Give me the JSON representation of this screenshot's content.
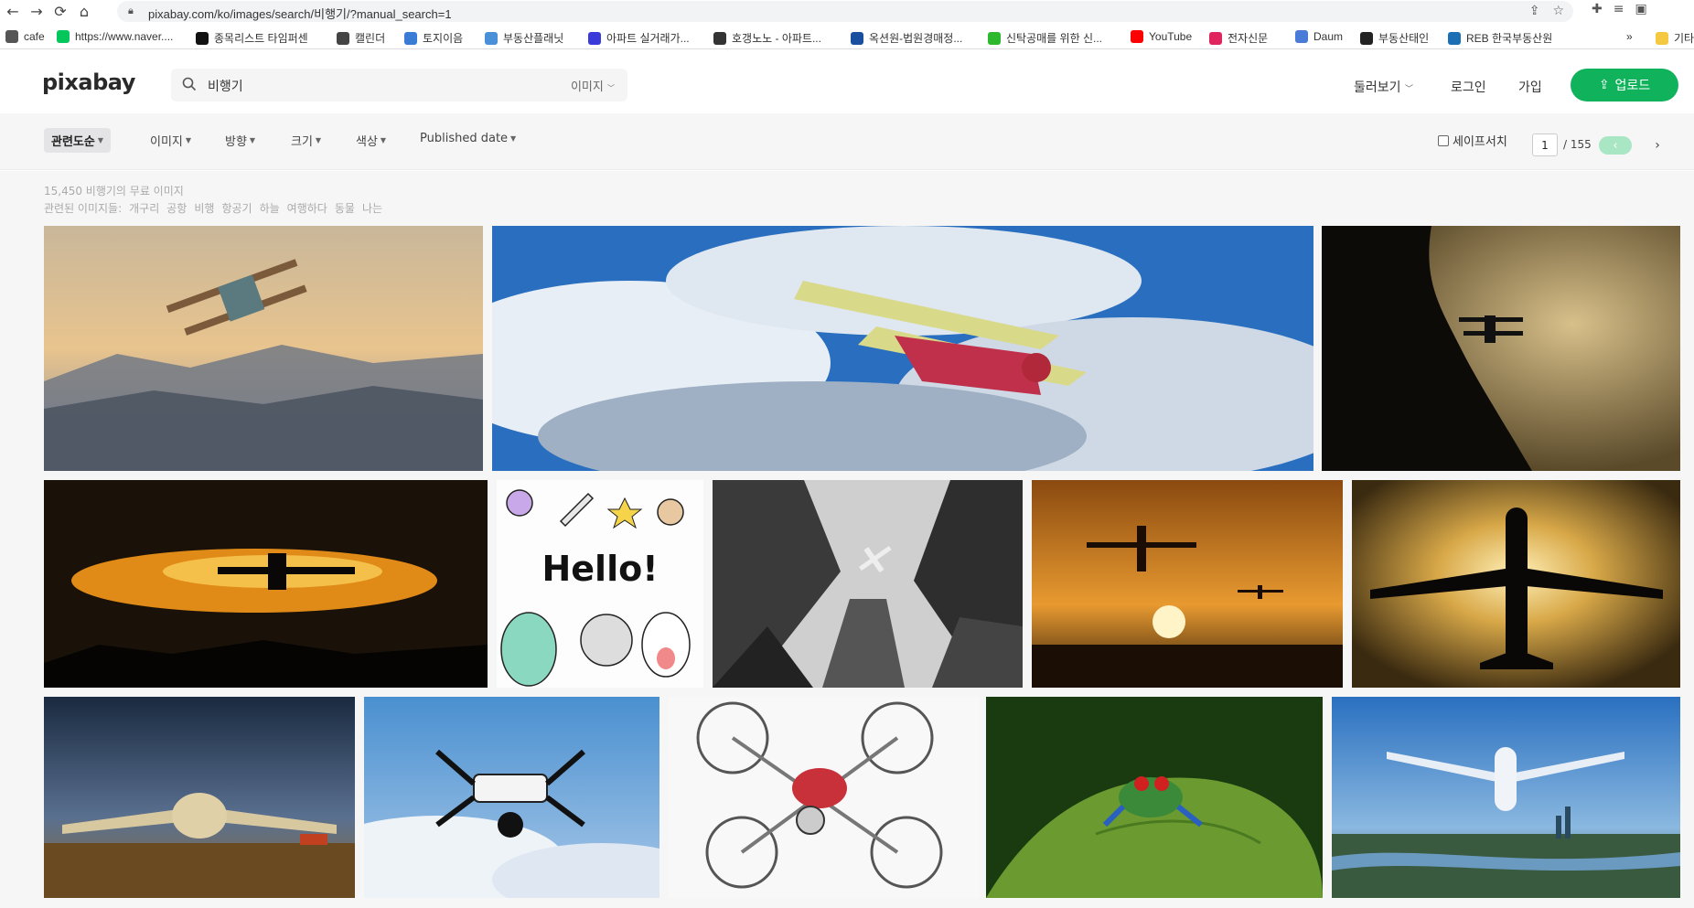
{
  "browser": {
    "url": "pixabay.com/ko/images/search/비행기/?manual_search=1",
    "bookmarks": [
      {
        "label": "cafe",
        "color": "#555555"
      },
      {
        "label": "https://www.naver....",
        "color": "#03c75a"
      },
      {
        "label": "종목리스트 타임퍼센",
        "color": "#111111"
      },
      {
        "label": "캘린더",
        "color": "#444444"
      },
      {
        "label": "토지이음",
        "color": "#3a7bd5"
      },
      {
        "label": "부동산플래닛",
        "color": "#4a90d9"
      },
      {
        "label": "아파트 실거래가...",
        "color": "#3a3adb"
      },
      {
        "label": "호갱노노 - 아파트...",
        "color": "#333333"
      },
      {
        "label": "옥션원-법원경매정...",
        "color": "#1a4fa0"
      },
      {
        "label": "신탁공매를 위한 신...",
        "color": "#2eb82e"
      },
      {
        "label": "YouTube",
        "color": "#ff0000"
      },
      {
        "label": "전자신문",
        "color": "#e0245e"
      },
      {
        "label": "Daum",
        "color": "#4a7bd8"
      },
      {
        "label": "부동산태인",
        "color": "#222222"
      },
      {
        "label": "REB 한국부동산원",
        "color": "#1a6fb5"
      }
    ],
    "more_bookmarks": "»",
    "other_folder": "기타"
  },
  "header": {
    "logo": "pixabay",
    "search_value": "비행기",
    "search_type": "이미지",
    "explore": "둘러보기",
    "login": "로그인",
    "join": "가입",
    "upload": "업로드"
  },
  "filters": {
    "sort": "관련도순",
    "type": "이미지",
    "orientation": "방향",
    "size": "크기",
    "color": "색상",
    "date": "Published date",
    "safe_search": "세이프서치",
    "page_current": "1",
    "page_total": "/ 155"
  },
  "results": {
    "count_text": "15,450 비행기의 무료 이미지",
    "related_label": "관련된 이미지들:",
    "related_tags": [
      "개구리",
      "공항",
      "비행",
      "항공기",
      "하늘",
      "여행하다",
      "동물",
      "나는"
    ],
    "hello_text": "Hello!"
  },
  "colors": {
    "brand_green": "#10b35c",
    "page_prev": "#a8e6c4"
  }
}
